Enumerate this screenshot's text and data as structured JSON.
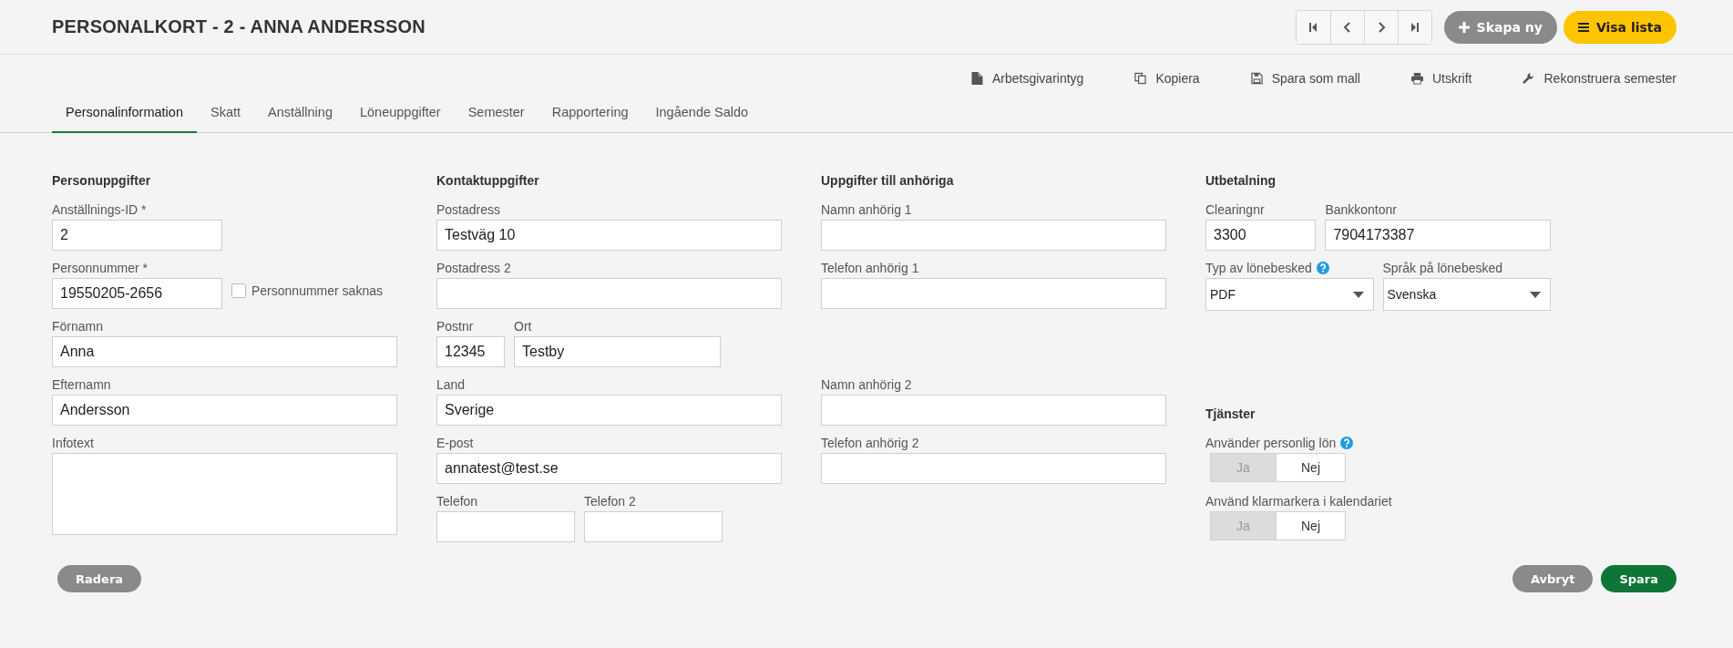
{
  "title": "PERSONALKORT - 2 - ANNA ANDERSSON",
  "header_buttons": [
    {
      "kind": "create",
      "label": "Skapa ny"
    },
    {
      "kind": "list",
      "label": "Visa lista"
    }
  ],
  "actions": [
    {
      "label": "Arbetsgivarintyg"
    },
    {
      "label": "Kopiera"
    },
    {
      "label": "Spara som mall"
    },
    {
      "label": "Utskrift"
    },
    {
      "label": "Rekonstruera semester"
    }
  ],
  "tabs": [
    {
      "label": "Personalinformation",
      "selected": true
    },
    {
      "label": "Skatt",
      "selected": false
    },
    {
      "label": "Anställning",
      "selected": false
    },
    {
      "label": "Löneuppgifter",
      "selected": false
    },
    {
      "label": "Semester",
      "selected": false
    },
    {
      "label": "Rapportering",
      "selected": false
    },
    {
      "label": "Ingående Saldo",
      "selected": false
    }
  ],
  "columns": [
    {
      "sections": [
        {
          "heading": "Personuppgifter",
          "rows": [
            [
              {
                "kind": "text",
                "label": "Anställnings-ID *",
                "value": "2"
              }
            ],
            [
              {
                "kind": "text",
                "label": "Personnummer *",
                "value": "19550205-2656"
              },
              {
                "kind": "checkbox",
                "label": "Personnummer saknas",
                "checked": false
              }
            ],
            [
              {
                "kind": "text",
                "label": "Förnamn",
                "value": "Anna"
              }
            ],
            [
              {
                "kind": "text",
                "label": "Efternamn",
                "value": "Andersson"
              }
            ],
            [
              {
                "kind": "textarea",
                "label": "Infotext"
              }
            ]
          ]
        }
      ]
    },
    {
      "sections": [
        {
          "heading": "Kontaktuppgifter",
          "rows": [
            [
              {
                "kind": "text",
                "label": "Postadress",
                "value": "Testväg 10"
              }
            ],
            [
              {
                "kind": "text",
                "label": "Postadress 2"
              }
            ],
            [
              {
                "kind": "text",
                "label": "Postnr",
                "value": "12345"
              },
              {
                "kind": "text",
                "label": "Ort",
                "value": "Testby"
              }
            ],
            [
              {
                "kind": "text",
                "label": "Land",
                "value": "Sverige"
              }
            ],
            [
              {
                "kind": "text",
                "label": "E-post",
                "value": "annatest@test.se"
              }
            ],
            [
              {
                "kind": "text",
                "label": "Telefon"
              },
              {
                "kind": "text",
                "label": "Telefon 2"
              }
            ]
          ]
        }
      ]
    },
    {
      "sections": [
        {
          "heading": "Uppgifter till anhöriga",
          "rows": [
            [
              {
                "kind": "text",
                "label": "Namn anhörig 1"
              }
            ],
            [
              {
                "kind": "text",
                "label": "Telefon anhörig 1"
              }
            ]
          ]
        },
        {
          "rows": [
            [
              {
                "kind": "text",
                "label": "Namn anhörig 2"
              }
            ],
            [
              {
                "kind": "text",
                "label": "Telefon anhörig 2"
              }
            ]
          ]
        }
      ]
    },
    {
      "sections": [
        {
          "heading": "Utbetalning",
          "rows": [
            [
              {
                "kind": "text",
                "label": "Clearingnr",
                "value": "3300"
              },
              {
                "kind": "text",
                "label": "Bankkontonr",
                "value": "7904173387"
              }
            ],
            [
              {
                "kind": "select",
                "label": "Typ av lönebesked",
                "help": true,
                "value": "PDF"
              },
              {
                "kind": "select",
                "label": "Språk på lönebesked",
                "value": "Svenska"
              }
            ]
          ]
        },
        {
          "heading": "Tjänster",
          "rows": [
            [
              {
                "kind": "toggle",
                "label": "Använder personlig lön",
                "help": true,
                "options": [
                  {
                    "label": "Ja",
                    "selected": true
                  },
                  {
                    "label": "Nej",
                    "selected": false
                  }
                ]
              }
            ],
            [
              {
                "kind": "toggle",
                "label": "Använd klarmarkera i kalendariet",
                "options": [
                  {
                    "label": "Ja",
                    "selected": true
                  },
                  {
                    "label": "Nej",
                    "selected": false
                  }
                ]
              }
            ]
          ]
        }
      ]
    }
  ],
  "footer_buttons": [
    {
      "kind": "delete",
      "label": "Radera"
    },
    {
      "kind": "cancel",
      "label": "Avbryt"
    },
    {
      "kind": "save",
      "label": "Spara"
    }
  ]
}
